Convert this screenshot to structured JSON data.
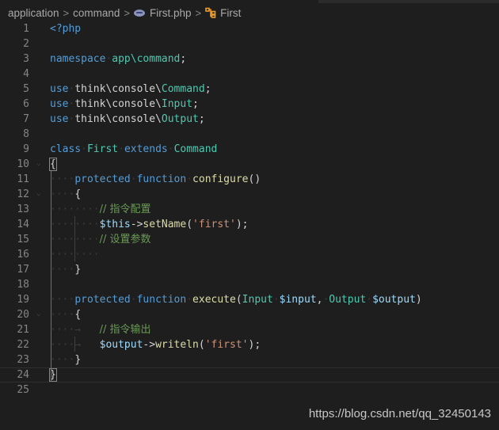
{
  "breadcrumb": {
    "items": [
      {
        "label": "application",
        "icon": null
      },
      {
        "label": "command",
        "icon": null
      },
      {
        "label": "First.php",
        "icon": "php-file-icon"
      },
      {
        "label": "First",
        "icon": "class-icon"
      }
    ],
    "separator": ">"
  },
  "editor": {
    "language": "php",
    "lines": [
      {
        "n": "1",
        "tokens": [
          [
            "kw",
            "<?php"
          ]
        ]
      },
      {
        "n": "2",
        "tokens": []
      },
      {
        "n": "3",
        "tokens": [
          [
            "kw",
            "namespace"
          ],
          [
            "ws",
            "·"
          ],
          [
            "ty",
            "app\\command"
          ],
          [
            "pl",
            ";"
          ]
        ]
      },
      {
        "n": "4",
        "tokens": []
      },
      {
        "n": "5",
        "tokens": [
          [
            "kw",
            "use"
          ],
          [
            "ws",
            "·"
          ],
          [
            "pl",
            "think\\console\\"
          ],
          [
            "ty",
            "Command"
          ],
          [
            "pl",
            ";"
          ]
        ]
      },
      {
        "n": "6",
        "tokens": [
          [
            "kw",
            "use"
          ],
          [
            "ws",
            "·"
          ],
          [
            "pl",
            "think\\console\\"
          ],
          [
            "ty",
            "Input"
          ],
          [
            "pl",
            ";"
          ]
        ]
      },
      {
        "n": "7",
        "tokens": [
          [
            "kw",
            "use"
          ],
          [
            "ws",
            "·"
          ],
          [
            "pl",
            "think\\console\\"
          ],
          [
            "ty",
            "Output"
          ],
          [
            "pl",
            ";"
          ]
        ]
      },
      {
        "n": "8",
        "tokens": []
      },
      {
        "n": "9",
        "tokens": [
          [
            "kw",
            "class"
          ],
          [
            "ws",
            "·"
          ],
          [
            "ty",
            "First"
          ],
          [
            "ws",
            "·"
          ],
          [
            "kw",
            "extends"
          ],
          [
            "ws",
            "·"
          ],
          [
            "ty",
            "Command"
          ]
        ]
      },
      {
        "n": "10",
        "fold": true,
        "tokens": [
          [
            "pl",
            "{"
          ]
        ]
      },
      {
        "n": "11",
        "tokens": [
          [
            "ws",
            "····"
          ],
          [
            "kw",
            "protected"
          ],
          [
            "ws",
            "·"
          ],
          [
            "kw",
            "function"
          ],
          [
            "ws",
            "·"
          ],
          [
            "fn",
            "configure"
          ],
          [
            "pl",
            "()"
          ]
        ]
      },
      {
        "n": "12",
        "fold": true,
        "tokens": [
          [
            "ws",
            "····"
          ],
          [
            "pl",
            "{"
          ]
        ]
      },
      {
        "n": "13",
        "tokens": [
          [
            "ws",
            "········"
          ],
          [
            "cm",
            "// 指令配置"
          ]
        ]
      },
      {
        "n": "14",
        "tokens": [
          [
            "ws",
            "········"
          ],
          [
            "var",
            "$this"
          ],
          [
            "pl",
            "->"
          ],
          [
            "fn",
            "setName"
          ],
          [
            "pl",
            "("
          ],
          [
            "str",
            "'first'"
          ],
          [
            "pl",
            ");"
          ]
        ]
      },
      {
        "n": "15",
        "tokens": [
          [
            "ws",
            "········"
          ],
          [
            "cm",
            "// 设置参数"
          ]
        ]
      },
      {
        "n": "16",
        "tokens": [
          [
            "ws",
            "········"
          ]
        ]
      },
      {
        "n": "17",
        "tokens": [
          [
            "ws",
            "····"
          ],
          [
            "pl",
            "}"
          ]
        ]
      },
      {
        "n": "18",
        "tokens": []
      },
      {
        "n": "19",
        "tokens": [
          [
            "ws",
            "····"
          ],
          [
            "kw",
            "protected"
          ],
          [
            "ws",
            "·"
          ],
          [
            "kw",
            "function"
          ],
          [
            "ws",
            "·"
          ],
          [
            "fn",
            "execute"
          ],
          [
            "pl",
            "("
          ],
          [
            "ty",
            "Input"
          ],
          [
            "ws",
            "·"
          ],
          [
            "var",
            "$input"
          ],
          [
            "pl",
            ","
          ],
          [
            "ws",
            "·"
          ],
          [
            "ty",
            "Output"
          ],
          [
            "ws",
            "·"
          ],
          [
            "var",
            "$output"
          ],
          [
            "pl",
            ")"
          ]
        ]
      },
      {
        "n": "20",
        "fold": true,
        "tokens": [
          [
            "ws",
            "····"
          ],
          [
            "pl",
            "{"
          ]
        ]
      },
      {
        "n": "21",
        "tokens": [
          [
            "ws",
            "····→   "
          ],
          [
            "cm",
            "// 指令输出"
          ]
        ]
      },
      {
        "n": "22",
        "tokens": [
          [
            "ws",
            "····→   "
          ],
          [
            "var",
            "$output"
          ],
          [
            "pl",
            "->"
          ],
          [
            "fn",
            "writeln"
          ],
          [
            "pl",
            "("
          ],
          [
            "str",
            "'first'"
          ],
          [
            "pl",
            ");"
          ]
        ]
      },
      {
        "n": "23",
        "tokens": [
          [
            "ws",
            "····"
          ],
          [
            "pl",
            "}"
          ]
        ]
      },
      {
        "n": "24",
        "current": true,
        "tokens": [
          [
            "pl",
            "}"
          ]
        ]
      },
      {
        "n": "25",
        "tokens": []
      }
    ]
  },
  "watermark": "https://blog.csdn.net/qq_32450143"
}
